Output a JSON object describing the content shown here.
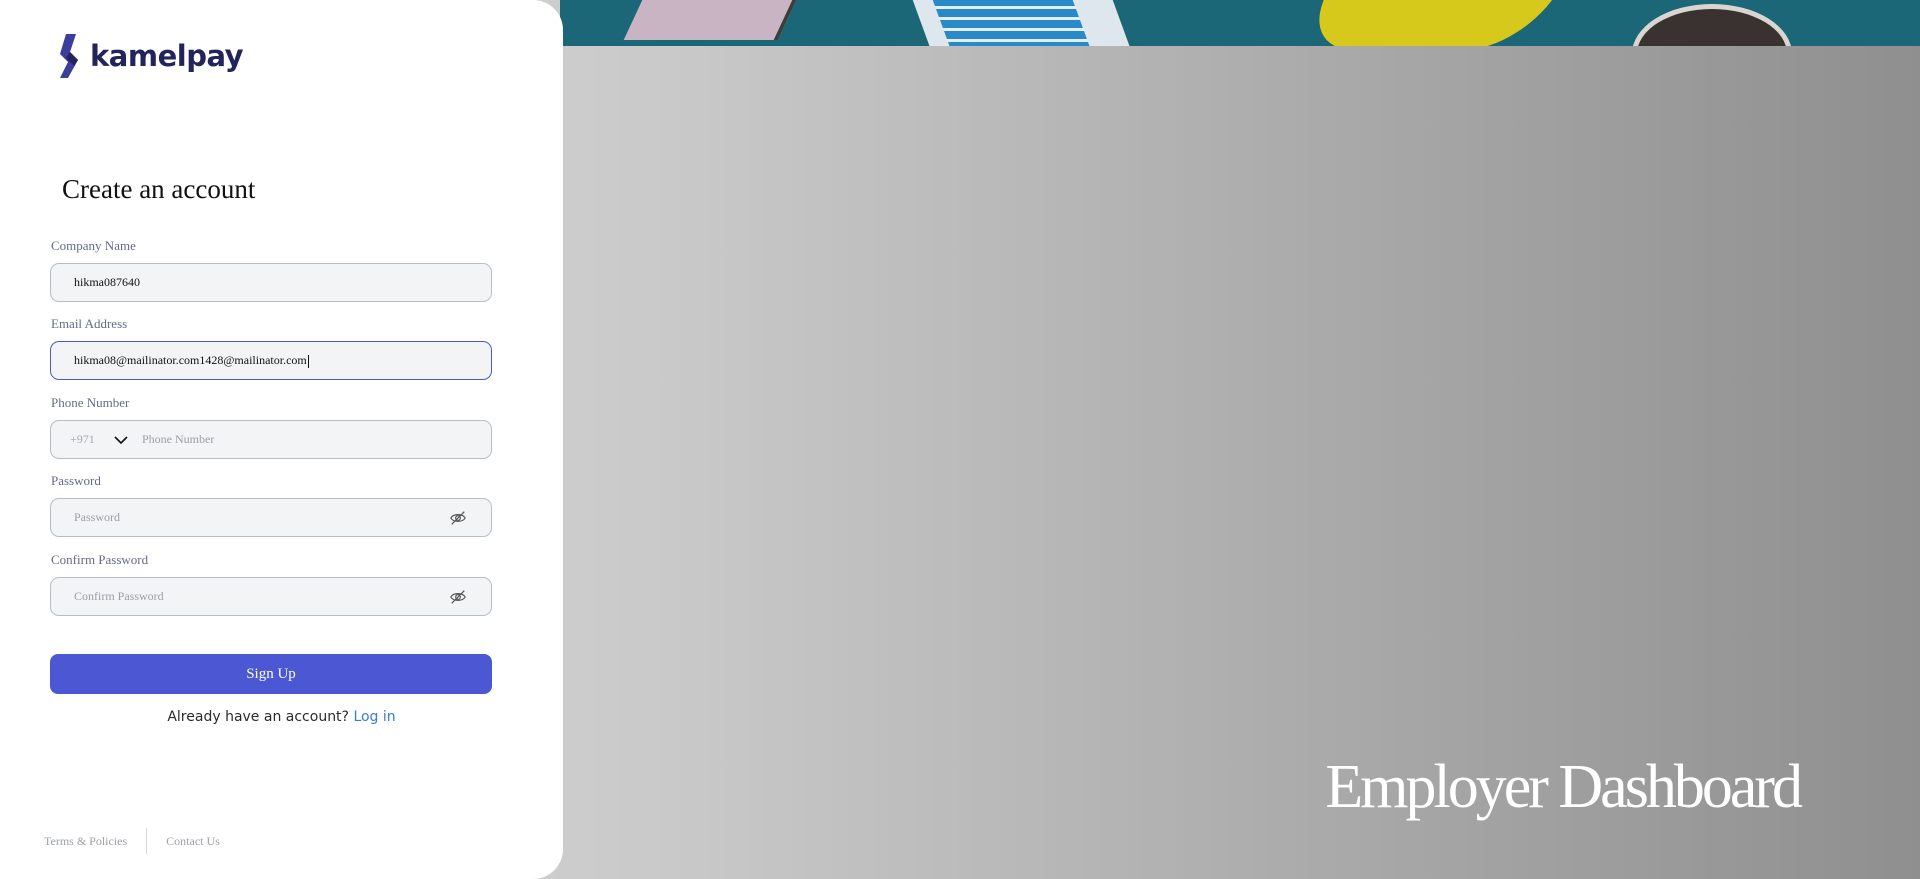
{
  "brand": {
    "name_part1": "kamel",
    "name_part2": "pay",
    "logo_icon": "kamelpay-logo-mark",
    "color_primary": "#23245a"
  },
  "form": {
    "heading": "Create an account",
    "company": {
      "label": "Company Name",
      "value": "hikma087640"
    },
    "email": {
      "label": "Email Address",
      "value": "hikma08@mailinator.com1428@mailinator.com"
    },
    "phone": {
      "label": "Phone Number",
      "country_code": "+971",
      "placeholder": "Phone Number"
    },
    "password": {
      "label": "Password",
      "placeholder": "Password",
      "icon": "eye-off-icon"
    },
    "confirm_password": {
      "label": "Confirm Password",
      "placeholder": "Confirm Password",
      "icon": "eye-off-icon"
    },
    "submit_label": "Sign Up",
    "login_prompt": "Already have an account?",
    "login_link": "Log in"
  },
  "footer": {
    "terms": "Terms & Policies",
    "contact": "Contact Us"
  },
  "hero": {
    "title": "Employer Dashboard"
  },
  "colors": {
    "accent": "#4b57d3",
    "link": "#3a7bd5",
    "focus_border": "#4b57d3"
  }
}
